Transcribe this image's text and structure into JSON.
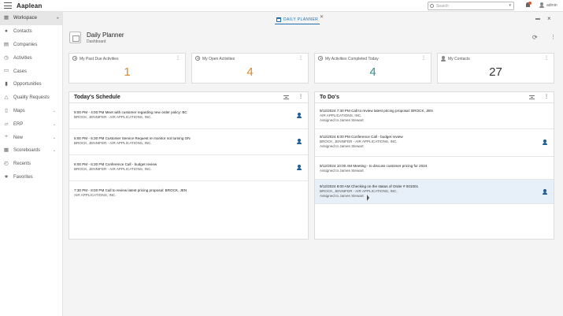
{
  "app": {
    "logo": "Aaplean"
  },
  "topbar": {
    "search_placeholder": "Search",
    "user_name": "admin"
  },
  "sidebar": {
    "items": [
      {
        "label": "Workspace",
        "icon": "workspace-icon",
        "glyph": "▦",
        "active": true
      },
      {
        "label": "Contacts",
        "icon": "person-icon",
        "glyph": "👤"
      },
      {
        "label": "Companies",
        "icon": "building-icon",
        "glyph": "▤"
      },
      {
        "label": "Activities",
        "icon": "clock-icon",
        "glyph": "◷"
      },
      {
        "label": "Cases",
        "icon": "chat-icon",
        "glyph": "▭"
      },
      {
        "label": "Opportunities",
        "icon": "chart-icon",
        "glyph": "▮"
      },
      {
        "label": "Quality Requests",
        "icon": "warning-icon",
        "glyph": "△"
      },
      {
        "label": "Maps",
        "icon": "map-icon",
        "glyph": "▯",
        "expandable": true
      },
      {
        "label": "ERP",
        "icon": "folder-icon",
        "glyph": "▱",
        "expandable": true
      },
      {
        "label": "New",
        "icon": "plus-icon",
        "glyph": "+",
        "expandable": true
      },
      {
        "label": "Scoreboards",
        "icon": "scoreboard-icon",
        "glyph": "▩",
        "expandable": true
      },
      {
        "label": "Recents",
        "icon": "history-icon",
        "glyph": "◴"
      },
      {
        "label": "Favorites",
        "icon": "star-icon",
        "glyph": "★"
      }
    ]
  },
  "tabbar": {
    "tab_label": "DAILY PLANNER"
  },
  "header": {
    "title": "Daily Planner",
    "subtitle": "Dashboard"
  },
  "cards": [
    {
      "label": "My Past Due Activities",
      "value": "1",
      "color": "#d98a2b",
      "icon": "clock"
    },
    {
      "label": "My Open Activities",
      "value": "4",
      "color": "#d98a2b",
      "icon": "clock"
    },
    {
      "label": "My Activities Completed Today",
      "value": "4",
      "color": "#3d8a8a",
      "icon": "clock"
    },
    {
      "label": "My Contacts",
      "value": "27",
      "color": "#333333",
      "icon": "person"
    }
  ],
  "schedule": {
    "title": "Today's Schedule",
    "rows": [
      {
        "line1": "9:00 PM - 4:00 PM Meet with customer regarding new order policy: BC",
        "line2": "BROCK, JENNIFER - AIR APPLICATIONS, INC."
      },
      {
        "line1": "5:00 PM - 5:30 PM Customer Service Request re monitor not turning ON",
        "line2": "BROCK, JENNIFER - AIR APPLICATIONS, INC."
      },
      {
        "line1": "6:00 PM - 6:30 PM Conference Call - budget review",
        "line2": "BROCK, JENNIFER - AIR APPLICATIONS, INC."
      },
      {
        "line1": "7:30 PM - 8:00 PM Call to review latest pricing proposal: BROCK, JEN",
        "line2": "AIR APPLICATIONS, INC."
      }
    ]
  },
  "todos": {
    "title": "To Do's",
    "rows": [
      {
        "line1": "9/12/2024 7:30 PM Call to review latest pricing proposal: BROCK, JEN",
        "line2": "AIR APPLICATIONS, INC.",
        "line3": "Assigned to James Stewart"
      },
      {
        "line1": "9/12/2024 6:00 PM Conference Call - budget review",
        "line2": "BROCK, JENNIFER - AIR APPLICATIONS, INC.",
        "line3": "Assigned to James Stewart"
      },
      {
        "line1": "9/12/2024 10:00 AM Meeting - to discuss customer pricing for 2024",
        "line2": "Assigned to James Stewart"
      },
      {
        "line1": "9/12/2024 8:00 AM Checking on the status of Order # 001001",
        "line2": "BROCK, JENNIFER - AIR APPLICATIONS, INC.",
        "line3": "Assigned to James Stewart"
      }
    ]
  }
}
